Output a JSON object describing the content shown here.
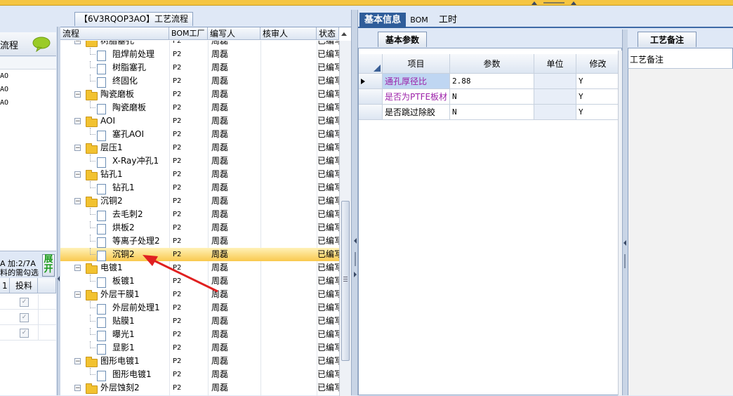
{
  "top_tab": "【6V3RQOP3AO】工艺流程",
  "left_panel": {
    "title": "流程",
    "list_items": [
      "AO",
      "AO",
      "AO"
    ],
    "info_line1": "A 加:2/7A",
    "info_line2": "料的需勾选",
    "expand_button": "展开",
    "col1_header": "1",
    "col2_header": "投料",
    "checkbox_rows": [
      true,
      true,
      true
    ]
  },
  "tree": {
    "headers": [
      "流程",
      "BOM工厂",
      "编写人",
      "核审人",
      "状态"
    ],
    "rows": [
      {
        "level": 0,
        "type": "folder",
        "name": "树脂塞孔",
        "factory": "P2",
        "writer": "周磊",
        "reviewer": "",
        "status": "已编写",
        "expanded": true
      },
      {
        "level": 1,
        "type": "doc",
        "name": "阻焊前处理",
        "factory": "P2",
        "writer": "周磊",
        "reviewer": "",
        "status": "已编写"
      },
      {
        "level": 1,
        "type": "doc",
        "name": "树脂塞孔",
        "factory": "P2",
        "writer": "周磊",
        "reviewer": "",
        "status": "已编写"
      },
      {
        "level": 1,
        "type": "doc",
        "name": "终固化",
        "factory": "P2",
        "writer": "周磊",
        "reviewer": "",
        "status": "已编写"
      },
      {
        "level": 0,
        "type": "folder",
        "name": "陶瓷磨板",
        "factory": "P2",
        "writer": "周磊",
        "reviewer": "",
        "status": "已编写",
        "expanded": true
      },
      {
        "level": 1,
        "type": "doc",
        "name": "陶瓷磨板",
        "factory": "P2",
        "writer": "周磊",
        "reviewer": "",
        "status": "已编写"
      },
      {
        "level": 0,
        "type": "folder",
        "name": "AOI",
        "factory": "P2",
        "writer": "周磊",
        "reviewer": "",
        "status": "已编写",
        "expanded": true
      },
      {
        "level": 1,
        "type": "doc",
        "name": "塞孔AOI",
        "factory": "P2",
        "writer": "周磊",
        "reviewer": "",
        "status": "已编写"
      },
      {
        "level": 0,
        "type": "folder",
        "name": "层压1",
        "factory": "P2",
        "writer": "周磊",
        "reviewer": "",
        "status": "已编写",
        "expanded": true
      },
      {
        "level": 1,
        "type": "doc",
        "name": "X-Ray冲孔1",
        "factory": "P2",
        "writer": "周磊",
        "reviewer": "",
        "status": "已编写"
      },
      {
        "level": 0,
        "type": "folder",
        "name": "钻孔1",
        "factory": "P2",
        "writer": "周磊",
        "reviewer": "",
        "status": "已编写",
        "expanded": true
      },
      {
        "level": 1,
        "type": "doc",
        "name": "钻孔1",
        "factory": "P2",
        "writer": "周磊",
        "reviewer": "",
        "status": "已编写"
      },
      {
        "level": 0,
        "type": "folder",
        "name": "沉铜2",
        "factory": "P2",
        "writer": "周磊",
        "reviewer": "",
        "status": "已编写",
        "expanded": true
      },
      {
        "level": 1,
        "type": "doc",
        "name": "去毛刺2",
        "factory": "P2",
        "writer": "周磊",
        "reviewer": "",
        "status": "已编写"
      },
      {
        "level": 1,
        "type": "doc",
        "name": "烘板2",
        "factory": "P2",
        "writer": "周磊",
        "reviewer": "",
        "status": "已编写"
      },
      {
        "level": 1,
        "type": "doc",
        "name": "等离子处理2",
        "factory": "P2",
        "writer": "周磊",
        "reviewer": "",
        "status": "已编写"
      },
      {
        "level": 1,
        "type": "doc",
        "name": "沉铜2",
        "factory": "P2",
        "writer": "周磊",
        "reviewer": "",
        "status": "已编写",
        "selected": true
      },
      {
        "level": 0,
        "type": "folder",
        "name": "电镀1",
        "factory": "P2",
        "writer": "周磊",
        "reviewer": "",
        "status": "已编写",
        "expanded": true
      },
      {
        "level": 1,
        "type": "doc",
        "name": "板镀1",
        "factory": "P2",
        "writer": "周磊",
        "reviewer": "",
        "status": "已编写"
      },
      {
        "level": 0,
        "type": "folder",
        "name": "外层干膜1",
        "factory": "P2",
        "writer": "周磊",
        "reviewer": "",
        "status": "已编写",
        "expanded": true
      },
      {
        "level": 1,
        "type": "doc",
        "name": "外层前处理1",
        "factory": "P2",
        "writer": "周磊",
        "reviewer": "",
        "status": "已编写"
      },
      {
        "level": 1,
        "type": "doc",
        "name": "贴膜1",
        "factory": "P2",
        "writer": "周磊",
        "reviewer": "",
        "status": "已编写"
      },
      {
        "level": 1,
        "type": "doc",
        "name": "曝光1",
        "factory": "P2",
        "writer": "周磊",
        "reviewer": "",
        "status": "已编写"
      },
      {
        "level": 1,
        "type": "doc",
        "name": "显影1",
        "factory": "P2",
        "writer": "周磊",
        "reviewer": "",
        "status": "已编写"
      },
      {
        "level": 0,
        "type": "folder",
        "name": "图形电镀1",
        "factory": "P2",
        "writer": "周磊",
        "reviewer": "",
        "status": "已编写",
        "expanded": true
      },
      {
        "level": 1,
        "type": "doc",
        "name": "图形电镀1",
        "factory": "P2",
        "writer": "周磊",
        "reviewer": "",
        "status": "已编写"
      },
      {
        "level": 0,
        "type": "folder",
        "name": "外层蚀刻2",
        "factory": "P2",
        "writer": "周磊",
        "reviewer": "",
        "status": "已编写",
        "expanded": true
      }
    ]
  },
  "right_tabs": [
    "基本信息",
    "BOM",
    "工时"
  ],
  "params": {
    "subtab": "基本参数",
    "headers": [
      "项目",
      "参数",
      "单位",
      "修改"
    ],
    "rows": [
      {
        "item": "通孔厚径比",
        "value": "2.88",
        "unit": "",
        "modify": "Y",
        "color": "#9b1fa8"
      },
      {
        "item": "是否为PTFE板材",
        "value": "N",
        "unit": "",
        "modify": "Y",
        "color": "#9b1fa8"
      },
      {
        "item": "是否跳过除胶",
        "value": "N",
        "unit": "",
        "modify": "Y",
        "color": "#000000"
      }
    ]
  },
  "notes": {
    "tab": "工艺备注",
    "label": "工艺备注"
  },
  "colors": {
    "accent": "#2f5d9a",
    "selection": "#f9c94e",
    "arrow": "#e02020"
  }
}
